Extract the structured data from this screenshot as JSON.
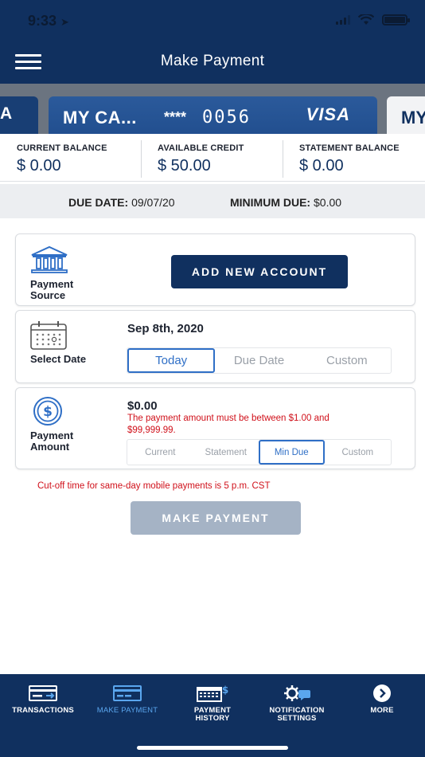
{
  "status": {
    "time": "9:33",
    "location_glyph": "➤"
  },
  "nav": {
    "title": "Make Payment"
  },
  "cards": {
    "left_peek": "A",
    "main": {
      "name": "MY CA...",
      "mask": "****",
      "last4": "0056",
      "brand": "VISA"
    },
    "right_peek": "MY"
  },
  "balances": [
    {
      "label": "CURRENT BALANCE",
      "value": "$ 0.00"
    },
    {
      "label": "AVAILABLE CREDIT",
      "value": "$ 50.00"
    },
    {
      "label": "STATEMENT BALANCE",
      "value": "$ 0.00"
    }
  ],
  "due": {
    "date_label": "DUE DATE:",
    "date_value": "09/07/20",
    "min_label": "MINIMUM DUE:",
    "min_value": "$0.00"
  },
  "payment_source": {
    "label_line1": "Payment",
    "label_line2": "Source",
    "add_button": "ADD NEW ACCOUNT"
  },
  "select_date": {
    "label": "Select Date",
    "value": "Sep 8th, 2020",
    "options": [
      "Today",
      "Due Date",
      "Custom"
    ],
    "selected": "Today"
  },
  "payment_amount": {
    "label_line1": "Payment",
    "label_line2": "Amount",
    "value": "$0.00",
    "error": "The payment amount must be between $1.00 and $99,999.99.",
    "options": [
      "Current",
      "Statement",
      "Min Due",
      "Custom"
    ],
    "selected": "Min Due"
  },
  "cutoff_notice": "Cut-off time for same-day mobile payments is 5 p.m. CST",
  "make_payment_button": "MAKE PAYMENT",
  "tabs": [
    {
      "line1": "TRANSACTIONS",
      "line2": "",
      "icon": "transactions-icon",
      "active": false
    },
    {
      "line1": "MAKE PAYMENT",
      "line2": "",
      "icon": "card-payment-icon",
      "active": true
    },
    {
      "line1": "PAYMENT",
      "line2": "HISTORY",
      "icon": "calendar-dollar-icon",
      "active": false
    },
    {
      "line1": "NOTIFICATION",
      "line2": "SETTINGS",
      "icon": "gear-chat-icon",
      "active": false
    },
    {
      "line1": "MORE",
      "line2": "",
      "icon": "chevron-circle-icon",
      "active": false
    }
  ],
  "colors": {
    "primary": "#10305f",
    "accent": "#2f6fc6",
    "error": "#d0101a",
    "active_tab": "#5aa6ee",
    "disabled_button": "#a5b3c5"
  }
}
